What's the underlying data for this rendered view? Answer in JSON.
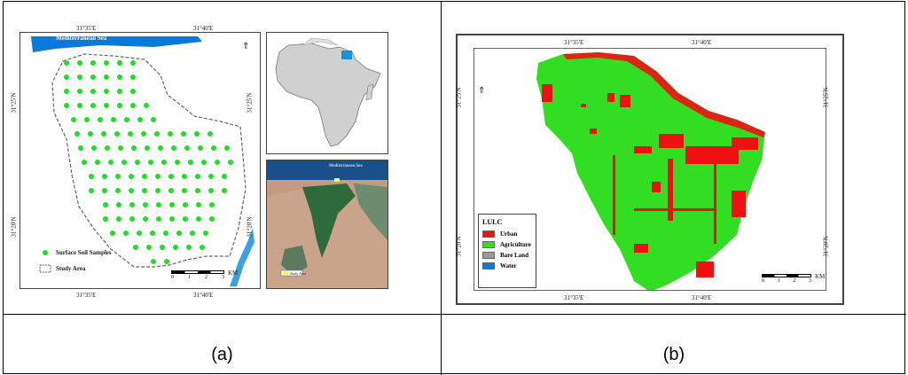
{
  "panel_a": {
    "caption": "(a)",
    "top_labels": [
      "31°35'E",
      "31°40'E"
    ],
    "bottom_labels": [
      "31°35'E",
      "31°40'E"
    ],
    "left_labels": [
      "31°25'N",
      "31°20'N"
    ],
    "right_labels": [
      "31°25'N",
      "31°20'N"
    ],
    "sea_label": "Mediterranean Sea",
    "legend": {
      "samples": "Surface Soil Samples",
      "study_area": "Study Area"
    },
    "scale": {
      "ticks": [
        "0",
        "1",
        "2",
        "3"
      ],
      "unit": "KM"
    },
    "inset_sea_label": "Mediterranean Sea",
    "inset_legend": "Study Area",
    "colors": {
      "samples": "#22dd22",
      "sea": "#0a7ad6",
      "egypt": "#1a8fe0"
    }
  },
  "panel_b": {
    "caption": "(b)",
    "top_labels": [
      "31°35'E",
      "31°40'E"
    ],
    "bottom_labels": [
      "31°35'E",
      "31°40'E"
    ],
    "left_labels": [
      "31°25'N",
      "31°20'N"
    ],
    "right_labels": [
      "31°25'N",
      "31°20'N"
    ],
    "legend_title": "LULC",
    "legend": [
      {
        "label": "Urban",
        "color": "#ee1111"
      },
      {
        "label": "Agriculture",
        "color": "#33dd22"
      },
      {
        "label": "Bare Land",
        "color": "#999999"
      },
      {
        "label": "Water",
        "color": "#1177dd"
      }
    ],
    "scale": {
      "ticks": [
        "0",
        "1",
        "2",
        "3"
      ],
      "unit": "KM"
    }
  }
}
